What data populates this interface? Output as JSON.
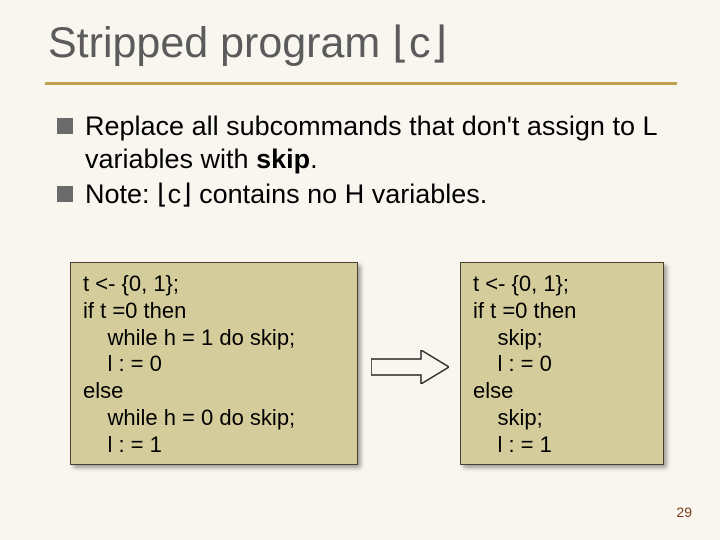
{
  "title": "Stripped program ⌊c⌋",
  "bullets": {
    "item1_pre": "Replace all subcommands that don't assign to L variables with ",
    "item1_bold": "skip",
    "item1_post": ".",
    "item2": "Note: ⌊c⌋ contains no H variables."
  },
  "code_left": "t <- {0, 1};\nif t =0 then\n    while h = 1 do skip;\n    l : = 0\nelse\n    while h = 0 do skip;\n    l : = 1",
  "code_right": "t <- {0, 1};\nif t =0 then\n    skip;\n    l : = 0\nelse\n    skip;\n    l : = 1",
  "page_number": "29"
}
